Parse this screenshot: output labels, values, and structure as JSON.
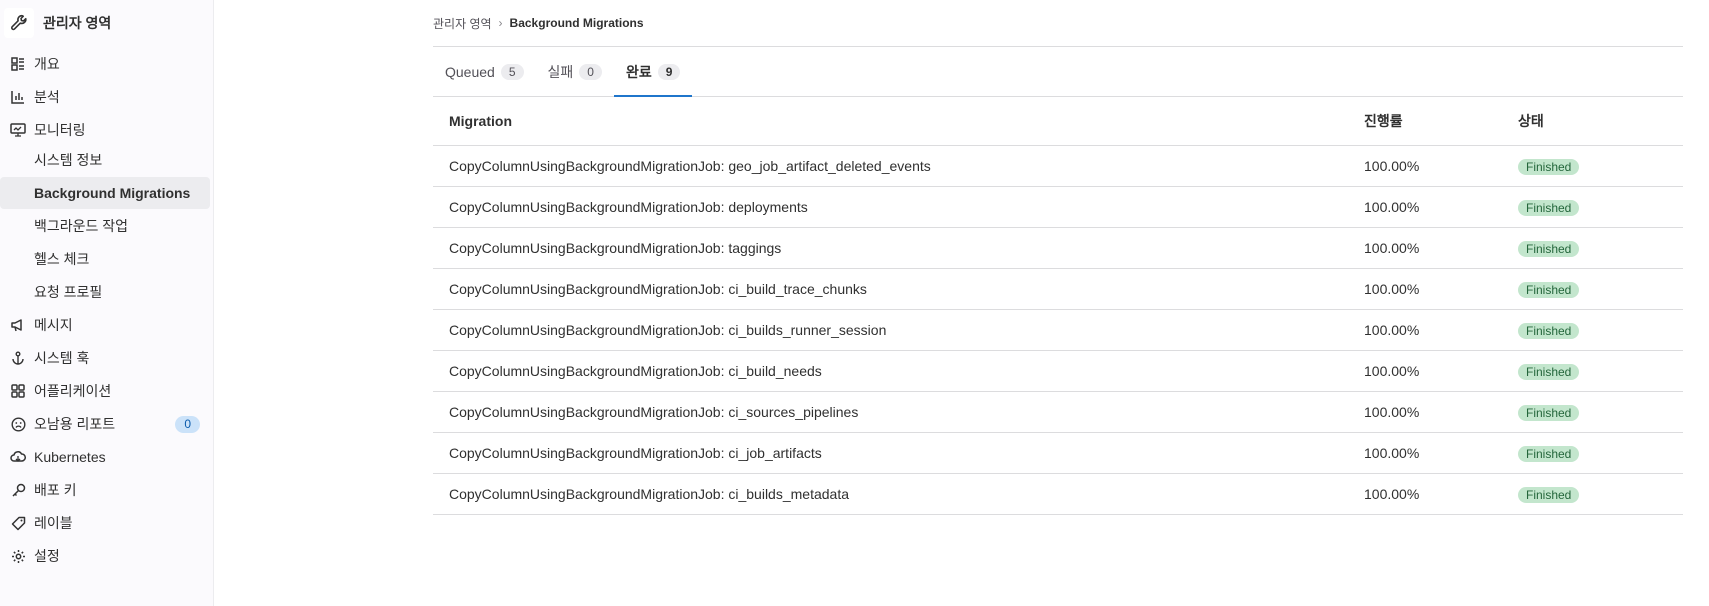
{
  "sidebar": {
    "title": "관리자 영역",
    "items": [
      {
        "label": "개요"
      },
      {
        "label": "분석"
      },
      {
        "label": "모니터링"
      },
      {
        "label": "메시지"
      },
      {
        "label": "시스템 훅"
      },
      {
        "label": "어플리케이션"
      },
      {
        "label": "오남용 리포트",
        "badge": "0"
      },
      {
        "label": "Kubernetes"
      },
      {
        "label": "배포 키"
      },
      {
        "label": "레이블"
      },
      {
        "label": "설정"
      }
    ],
    "monitoring_sub": [
      {
        "label": "시스템 정보"
      },
      {
        "label": "Background Migrations"
      },
      {
        "label": "백그라운드 작업"
      },
      {
        "label": "헬스 체크"
      },
      {
        "label": "요청 프로필"
      }
    ]
  },
  "breadcrumb": {
    "parent": "관리자 영역",
    "current": "Background Migrations"
  },
  "tabs": [
    {
      "label": "Queued",
      "count": "5"
    },
    {
      "label": "실패",
      "count": "0"
    },
    {
      "label": "완료",
      "count": "9"
    }
  ],
  "table": {
    "headers": {
      "migration": "Migration",
      "progress": "진행률",
      "status": "상태"
    },
    "rows": [
      {
        "migration": "CopyColumnUsingBackgroundMigrationJob: geo_job_artifact_deleted_events",
        "progress": "100.00%",
        "status": "Finished"
      },
      {
        "migration": "CopyColumnUsingBackgroundMigrationJob: deployments",
        "progress": "100.00%",
        "status": "Finished"
      },
      {
        "migration": "CopyColumnUsingBackgroundMigrationJob: taggings",
        "progress": "100.00%",
        "status": "Finished"
      },
      {
        "migration": "CopyColumnUsingBackgroundMigrationJob: ci_build_trace_chunks",
        "progress": "100.00%",
        "status": "Finished"
      },
      {
        "migration": "CopyColumnUsingBackgroundMigrationJob: ci_builds_runner_session",
        "progress": "100.00%",
        "status": "Finished"
      },
      {
        "migration": "CopyColumnUsingBackgroundMigrationJob: ci_build_needs",
        "progress": "100.00%",
        "status": "Finished"
      },
      {
        "migration": "CopyColumnUsingBackgroundMigrationJob: ci_sources_pipelines",
        "progress": "100.00%",
        "status": "Finished"
      },
      {
        "migration": "CopyColumnUsingBackgroundMigrationJob: ci_job_artifacts",
        "progress": "100.00%",
        "status": "Finished"
      },
      {
        "migration": "CopyColumnUsingBackgroundMigrationJob: ci_builds_metadata",
        "progress": "100.00%",
        "status": "Finished"
      }
    ]
  },
  "colors": {
    "accent": "#1f75cb",
    "status_bg": "#c3e6cd",
    "status_fg": "#24663b"
  },
  "icons": {
    "logo": "wrench-icon",
    "items": [
      "overview-grid-icon",
      "chart-icon",
      "monitor-icon",
      "megaphone-icon",
      "anchor-icon",
      "applications-icon",
      "abuse-face-icon",
      "cloud-icon",
      "key-icon",
      "label-icon",
      "settings-gear-icon"
    ]
  }
}
